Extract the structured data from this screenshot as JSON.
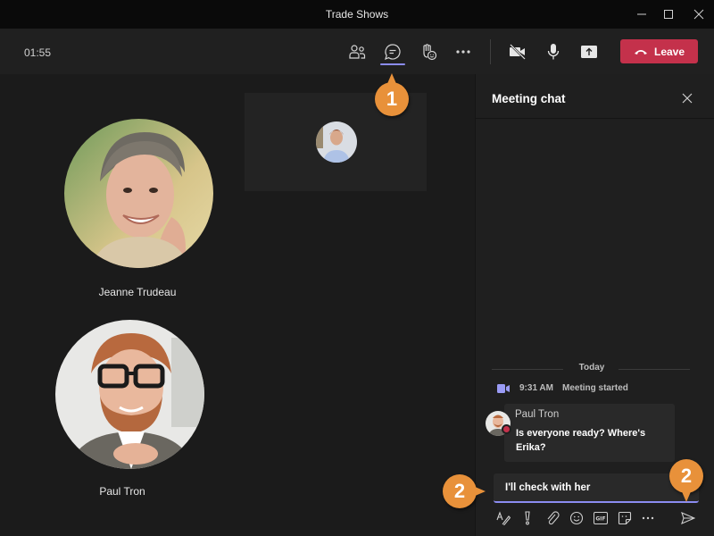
{
  "window": {
    "title": "Trade Shows",
    "controls": [
      "minimize",
      "maximize",
      "close"
    ]
  },
  "toolbar": {
    "timer": "01:55",
    "buttons": [
      {
        "name": "participants",
        "icon": "people-icon"
      },
      {
        "name": "chat",
        "icon": "chat-icon",
        "active": true
      },
      {
        "name": "reactions",
        "icon": "raise-hand-icon"
      },
      {
        "name": "more",
        "icon": "more-icon"
      },
      {
        "name": "camera",
        "icon": "camera-off-icon"
      },
      {
        "name": "mic",
        "icon": "mic-icon"
      },
      {
        "name": "share",
        "icon": "share-screen-icon"
      }
    ],
    "leave_label": "Leave",
    "leave_color": "#c4314b",
    "accent_color": "#8b8cf0"
  },
  "stage": {
    "participants": [
      {
        "name": "Jeanne Trudeau"
      },
      {
        "name": "Paul Tron"
      }
    ]
  },
  "chat": {
    "title": "Meeting chat",
    "date_divider": "Today",
    "system_event": {
      "time": "9:31 AM",
      "text": "Meeting started"
    },
    "messages": [
      {
        "sender": "Paul Tron",
        "text": "Is everyone ready? Where's Erika?"
      }
    ],
    "compose": {
      "value": "I'll check with her"
    },
    "format_tools": [
      "format-icon",
      "important-icon",
      "attach-icon",
      "emoji-icon",
      "gif-icon",
      "sticker-icon",
      "more-icon",
      "send-icon"
    ]
  },
  "callouts": [
    {
      "label": "1"
    },
    {
      "label": "2"
    },
    {
      "label": "2"
    }
  ]
}
